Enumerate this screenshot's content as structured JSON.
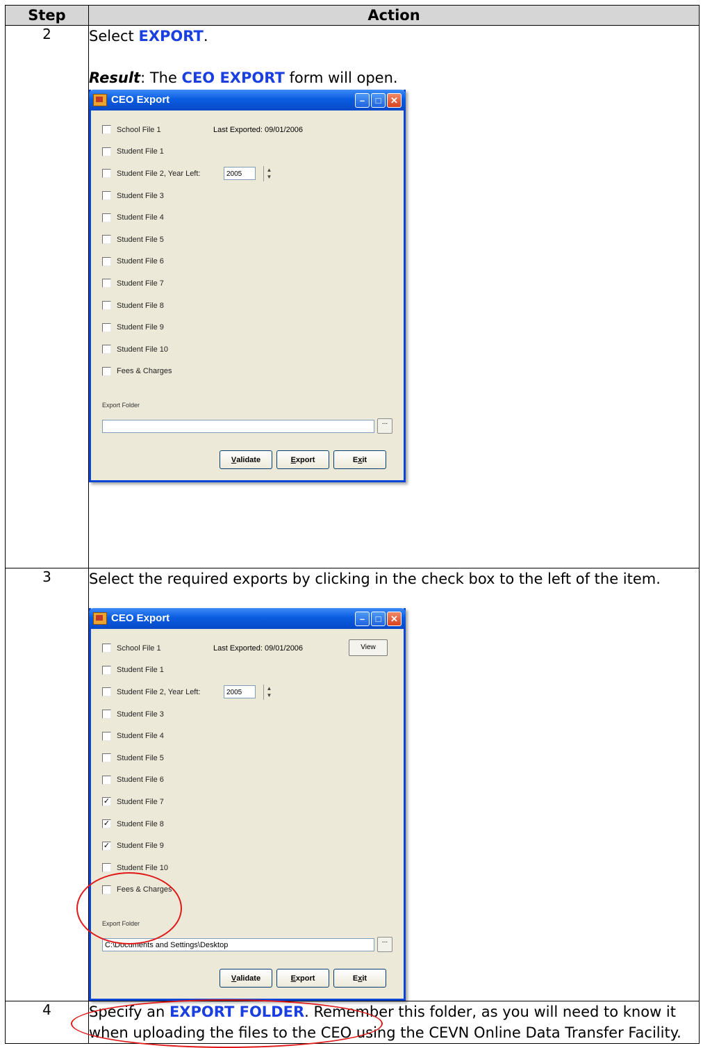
{
  "table": {
    "header_step": "Step",
    "header_action": "Action"
  },
  "row2": {
    "step": "2",
    "instr_pre": "Select ",
    "instr_kw": "EXPORT",
    "instr_post": ".",
    "result_label": "Result",
    "result_colon": ":  The ",
    "result_kw": "CEO EXPORT",
    "result_post": " form will open."
  },
  "row3": {
    "step": "3",
    "instr": "Select the required exports by clicking in the check box to the left of the item."
  },
  "row4": {
    "step": "4",
    "instr_pre": "Specify an ",
    "instr_kw": "EXPORT FOLDER",
    "instr_post": ".  Remember this folder, as you will need to know it when uploading the files to the CEO using the CEVN Online Data Transfer Facility."
  },
  "dialog": {
    "title": "CEO Export",
    "last_exported": "Last Exported: 09/01/2006",
    "year_value": "2005",
    "view_label": "View",
    "folder_label": "Export Folder",
    "browse_label": "...",
    "validate_u": "V",
    "validate_rest": "alidate",
    "export_u": "E",
    "export_rest": "xport",
    "exit_pre": "E",
    "exit_u": "x",
    "exit_rest": "it",
    "items": [
      "School File 1",
      "Student File 1",
      "Student File 2, Year Left:",
      "Student File 3",
      "Student File 4",
      "Student File 5",
      "Student File 6",
      "Student File 7",
      "Student File 8",
      "Student File 9",
      "Student File 10",
      "Fees & Charges"
    ]
  },
  "dialog1": {
    "folder_value": ""
  },
  "dialog2": {
    "folder_value": "C:\\Documents and Settings\\Desktop",
    "checked": [
      7,
      8,
      9
    ]
  }
}
